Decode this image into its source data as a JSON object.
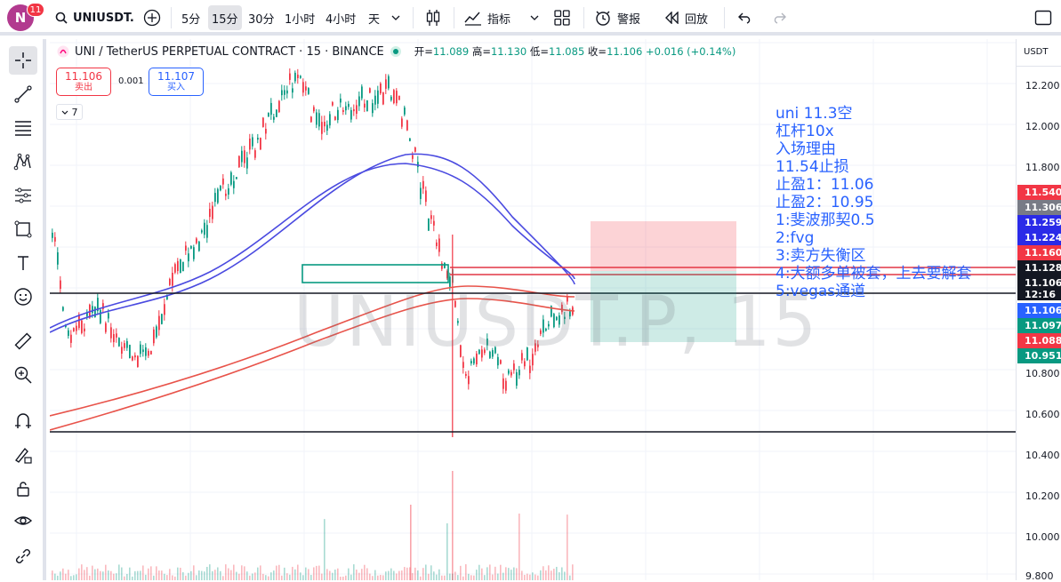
{
  "topbar": {
    "avatar_letter": "N",
    "badge_count": "11",
    "symbol": "UNIUSDT.",
    "timeframes": [
      "5分",
      "15分",
      "30分",
      "1小时",
      "4小时",
      "天"
    ],
    "indicators_label": "指标",
    "alert_label": "警报",
    "replay_label": "回放"
  },
  "legend": {
    "title": "UNI / TetherUS PERPETUAL CONTRACT · 15 · BINANCE",
    "open_label": "开=",
    "open": "11.089",
    "high_label": "高=",
    "high": "11.130",
    "low_label": "低=",
    "low": "11.085",
    "close_label": "收=",
    "close": "11.106",
    "change": "+0.016 (+0.14%)"
  },
  "trade": {
    "sell_price": "11.106",
    "sell_label": "卖出",
    "spread": "0.001",
    "buy_price": "11.107",
    "buy_label": "买入",
    "indicator_count": "7"
  },
  "watermark": "UNIUSDT.P, 15",
  "note_lines": [
    "uni 11.3空",
    "杠杆10x",
    "入场理由",
    "11.54止损",
    "止盈1：11.06",
    "止盈2：10.95",
    "1:斐波那契0.5",
    "2:fvg",
    "3:卖方失衡区",
    "4:大额多单被套，上去要解套",
    "5:vegas通道"
  ],
  "price_axis": {
    "currency": "USDT",
    "ticks": [
      "12.200",
      "12.000",
      "11.800",
      "10.800",
      "10.600",
      "10.400",
      "10.200",
      "10.000",
      "9.800"
    ],
    "tags": [
      {
        "text": "11.540",
        "color": "#f23645"
      },
      {
        "text": "11.306",
        "color": "#787b86"
      },
      {
        "text": "11.259",
        "color": "#2a2ae8"
      },
      {
        "text": "11.224",
        "color": "#2a2ae8"
      },
      {
        "text": "11.160",
        "color": "#f23645"
      },
      {
        "text": "11.128",
        "color": "#131722"
      },
      {
        "text": "11.106",
        "color": "#131722"
      },
      {
        "text": "12:16",
        "color": "#131722"
      },
      {
        "text": "11.106",
        "color": "#2962ff"
      },
      {
        "text": "11.097",
        "color": "#089981"
      },
      {
        "text": "11.088",
        "color": "#f23645"
      },
      {
        "text": "10.951",
        "color": "#089981"
      }
    ]
  },
  "colors": {
    "up": "#089981",
    "down": "#f23645",
    "ema_blue": "#4a4ae0",
    "ema_red": "#e8534a",
    "note": "#2962ff"
  },
  "icons": [
    "plus-circle-icon",
    "bar-style-icon",
    "indicators-icon",
    "layout-icon",
    "alert-icon",
    "replay-icon",
    "undo-icon",
    "redo-icon",
    "crosshair-icon",
    "trendline-icon",
    "fib-icon",
    "pattern-icon",
    "forecast-icon",
    "shapes-icon",
    "text-icon",
    "emoji-icon",
    "ruler-icon",
    "zoom-icon",
    "magnet-icon",
    "lock-draw-icon",
    "lock-icon",
    "eye-icon",
    "link-icon"
  ]
}
